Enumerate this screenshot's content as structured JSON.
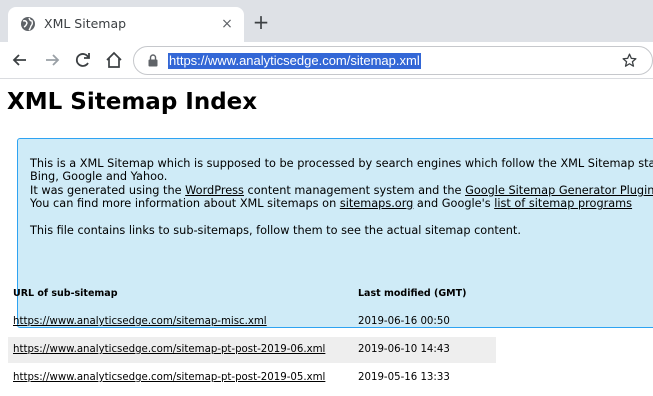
{
  "browser": {
    "tab": {
      "title": "XML Sitemap",
      "favicon": "globe-icon",
      "close": "×"
    },
    "new_tab": "+",
    "nav": {
      "back": "back-arrow-icon",
      "forward": "forward-arrow-icon",
      "reload": "reload-icon",
      "home": "home-icon"
    },
    "address_bar": {
      "url": "https://www.analyticsedge.com/sitemap.xml",
      "lock": "lock-icon",
      "bookmark": "star-icon"
    }
  },
  "page": {
    "title": "XML Sitemap Index",
    "intro": {
      "line1": "This is a XML Sitemap which is supposed to be processed by search engines which follow the XML Sitemap standard like Ask.com,",
      "line2": "Bing, Google and Yahoo.",
      "line3_pre": "It was generated using the ",
      "line3_link1": "WordPress",
      "line3_mid": " content management system and the ",
      "line3_link2": "Google Sitemap Generator Plugin",
      "line4_pre": "You can find more information about XML sitemaps on ",
      "line4_link1": "sitemaps.org",
      "line4_mid": " and Google's ",
      "line4_link2": "list of sitemap programs",
      "line5": "This file contains links to sub-sitemaps, follow them to see the actual sitemap content."
    },
    "table": {
      "headers": {
        "url": "URL of sub-sitemap",
        "modified": "Last modified (GMT)"
      },
      "rows": [
        {
          "url": "https://www.analyticsedge.com/sitemap-misc.xml",
          "modified": "2019-06-16 00:50"
        },
        {
          "url": "https://www.analyticsedge.com/sitemap-pt-post-2019-06.xml",
          "modified": "2019-06-10 14:43"
        },
        {
          "url": "https://www.analyticsedge.com/sitemap-pt-post-2019-05.xml",
          "modified": "2019-05-16 13:33"
        }
      ]
    }
  },
  "colors": {
    "tabstrip": "#dee1e6",
    "selection": "#3367d6",
    "intro_bg": "#cfebf7",
    "intro_border": "#2ea3f2",
    "row_alt": "#eeeeee"
  }
}
